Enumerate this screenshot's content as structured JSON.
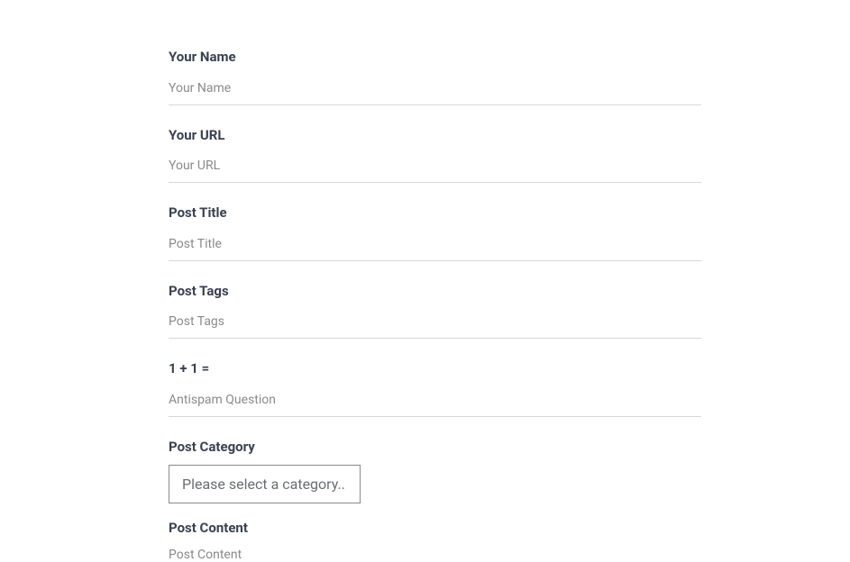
{
  "form": {
    "name": {
      "label": "Your Name",
      "placeholder": "Your Name",
      "value": ""
    },
    "url": {
      "label": "Your URL",
      "placeholder": "Your URL",
      "value": ""
    },
    "postTitle": {
      "label": "Post Title",
      "placeholder": "Post Title",
      "value": ""
    },
    "postTags": {
      "label": "Post Tags",
      "placeholder": "Post Tags",
      "value": ""
    },
    "antispam": {
      "label": "1 + 1 =",
      "placeholder": "Antispam Question",
      "value": ""
    },
    "postCategory": {
      "label": "Post Category",
      "selected": "Please select a category.."
    },
    "postContent": {
      "label": "Post Content",
      "placeholder": "Post Content",
      "value": ""
    }
  }
}
